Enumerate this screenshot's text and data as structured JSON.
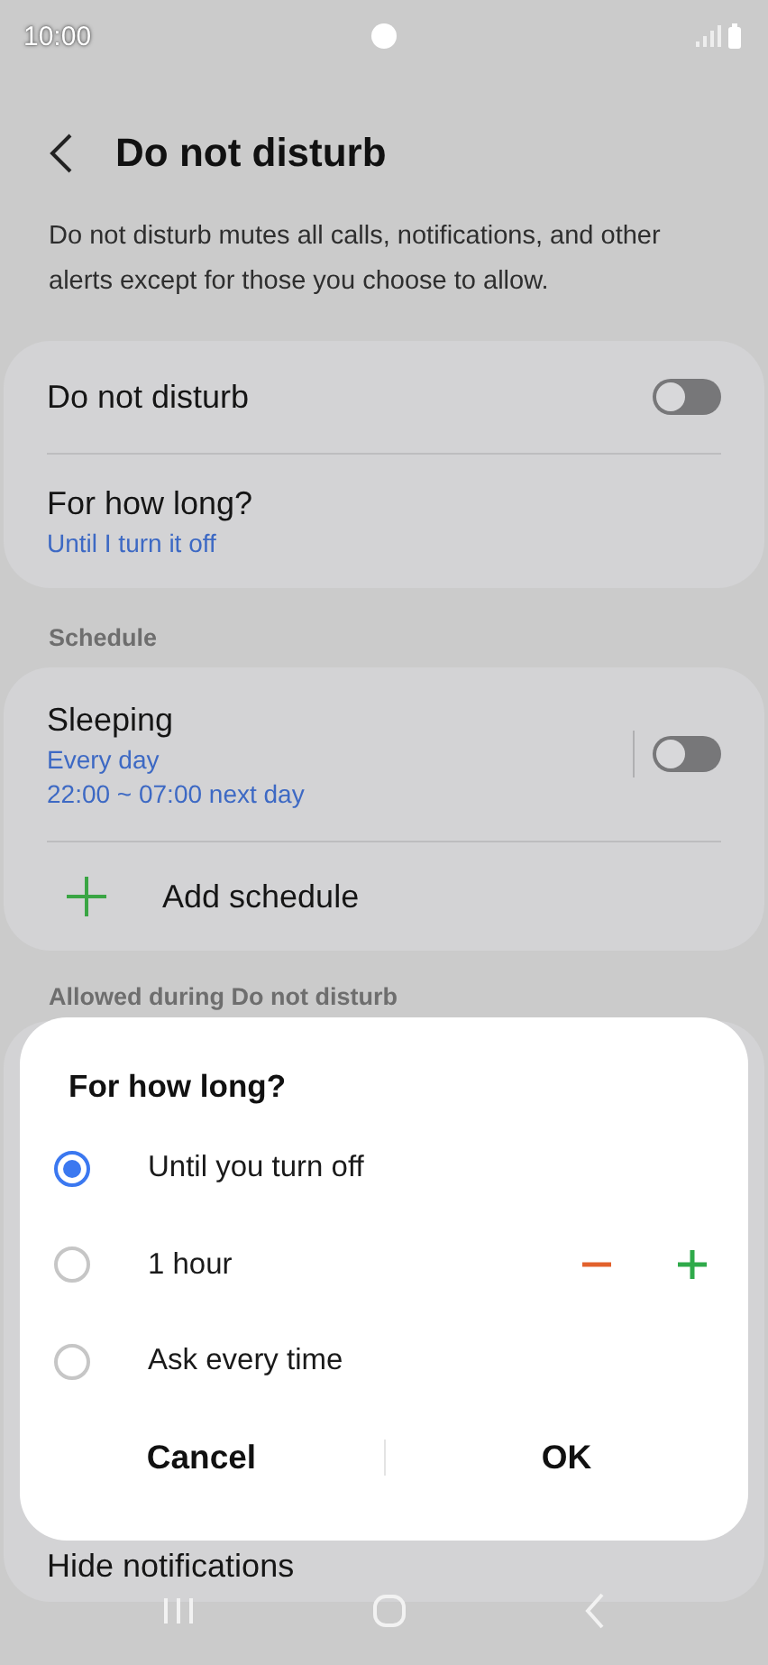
{
  "status_bar": {
    "time": "10:00"
  },
  "header": {
    "title": "Do not disturb"
  },
  "description": "Do not disturb mutes all calls, notifications, and other alerts except for those you choose to allow.",
  "main_card": {
    "rows": [
      {
        "kind": "toggle",
        "title": "Do not disturb",
        "on": false
      },
      {
        "kind": "value",
        "title": "For how long?",
        "value": "Until I turn it off"
      }
    ]
  },
  "schedule_section": {
    "header": "Schedule",
    "schedules": [
      {
        "name": "Sleeping",
        "days": "Every day",
        "time": "22:00 ~ 07:00 next day",
        "on": false
      }
    ],
    "add_label": "Add schedule"
  },
  "allowed_section": {
    "header": "Allowed during Do not disturb",
    "rows": [
      {
        "title": "Hide notifications"
      }
    ]
  },
  "dialog": {
    "title": "For how long?",
    "options": [
      {
        "kind": "plain",
        "label": "Until you turn off",
        "selected": true
      },
      {
        "kind": "stepper",
        "label": "1 hour",
        "selected": false
      },
      {
        "kind": "plain",
        "label": "Ask every time",
        "selected": false
      }
    ],
    "buttons": [
      "Cancel",
      "OK"
    ]
  }
}
